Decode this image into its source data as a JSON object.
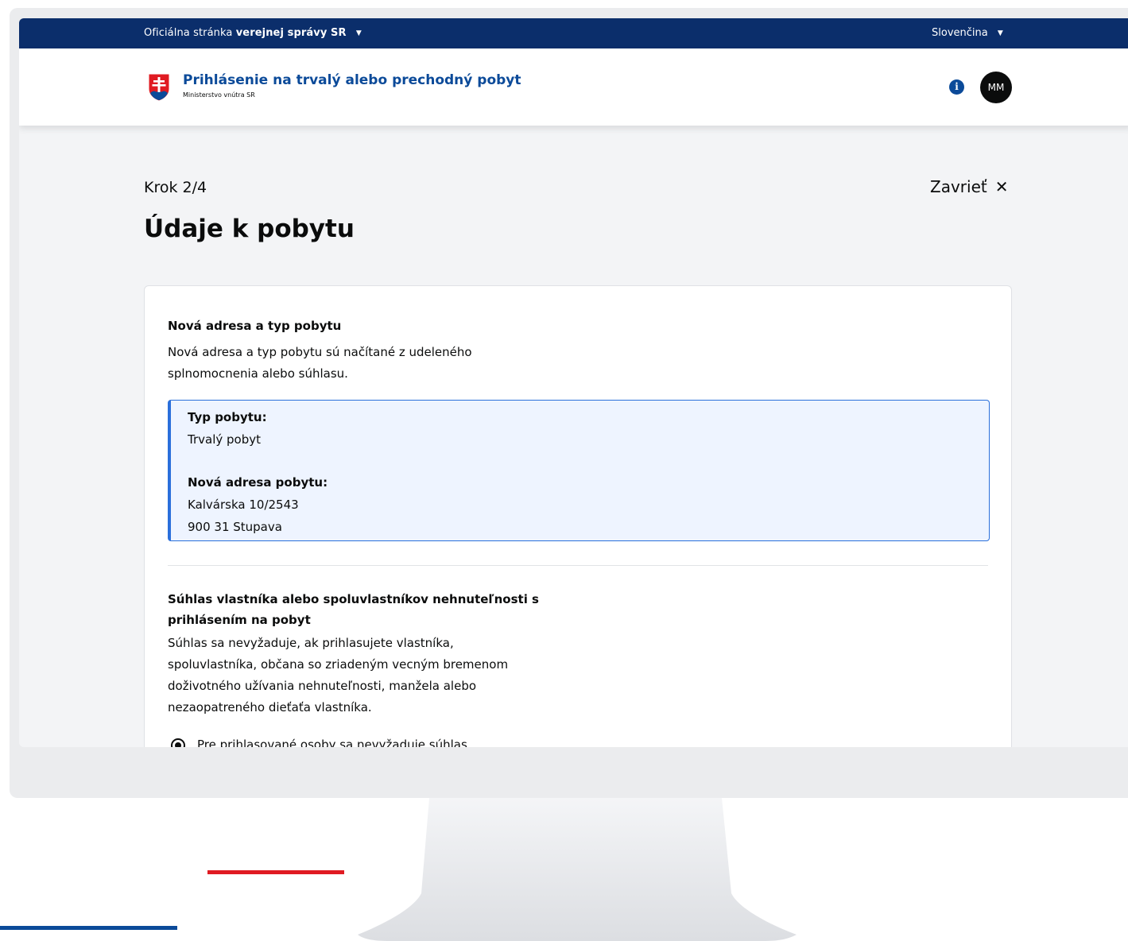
{
  "topbar": {
    "official_prefix": "Oficiálna stránka",
    "official_bold": "verejnej správy SR",
    "language": "Slovenčina"
  },
  "header": {
    "title": "Prihlásenie na trvalý alebo prechodný pobyt",
    "subtitle": "Ministerstvo vnútra SR",
    "avatar_initials": "MM"
  },
  "page": {
    "step": "Krok 2/4",
    "close_label": "Zavrieť",
    "title": "Údaje k pobytu"
  },
  "section_address": {
    "heading": "Nová adresa a typ pobytu",
    "desc_line1": "Nová adresa a typ pobytu sú načítané z udeleného",
    "desc_line2": "splnomocnenia alebo súhlasu.",
    "type_label": "Typ pobytu:",
    "type_value": "Trvalý pobyt",
    "address_label": "Nová adresa pobytu:",
    "address_line1": "Kalvárska 10/2543",
    "address_line2": "900 31 Stupava"
  },
  "section_consent": {
    "heading_line1": "Súhlas vlastníka alebo spoluvlastníkov nehnuteľnosti s",
    "heading_line2": "prihlásením na pobyt",
    "desc_line1": "Súhlas sa nevyžaduje, ak prihlasujete vlastníka,",
    "desc_line2": "spoluvlastníka, občana so zriadeným vecným bremenom",
    "desc_line3": "doživotného užívania nehnuteľnosti, manžela alebo",
    "desc_line4": "nezaopatreného dieťaťa vlastníka.",
    "radio_option": "Pre prihlasované osoby sa nevyžaduje súhlas"
  },
  "colors": {
    "topbar_bg": "#0b2e6b",
    "brand_blue": "#0b4a99",
    "info_border": "#2a6fdb",
    "info_bg": "#eef4ff",
    "accent_red": "#e01b22"
  }
}
